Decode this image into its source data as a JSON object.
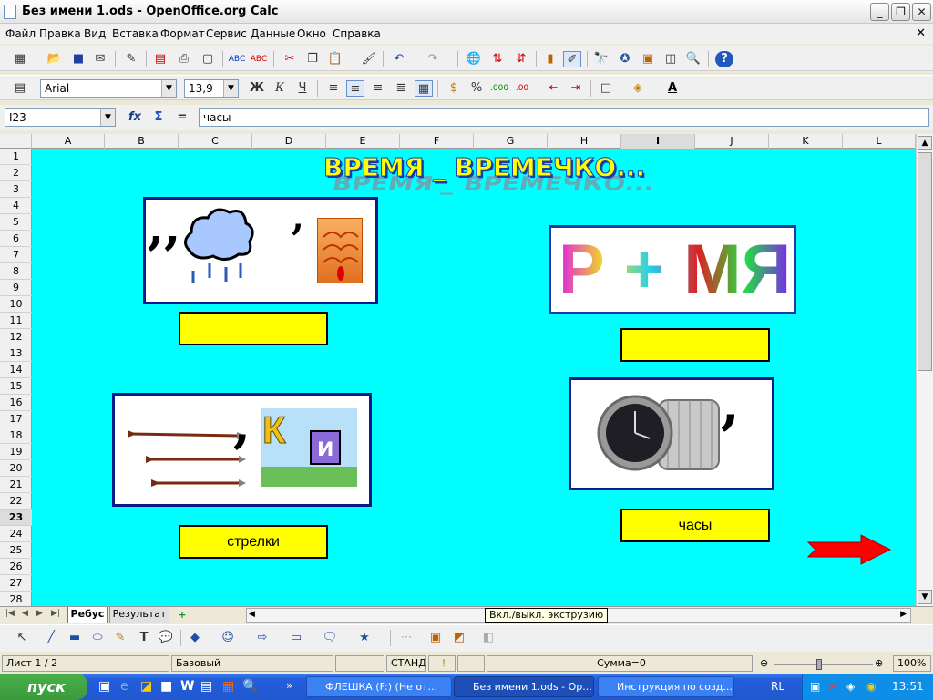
{
  "window": {
    "title": "Без имени 1.ods - OpenOffice.org Calc"
  },
  "menu": [
    "Файл",
    "Правка",
    "Вид",
    "Вставка",
    "Формат",
    "Сервис",
    "Данные",
    "Окно",
    "Справка"
  ],
  "font_toolbar": {
    "font_name": "Arial",
    "font_size": "13,9",
    "bold": "Ж",
    "italic": "К",
    "underline": "Ч"
  },
  "formula_bar": {
    "cell_ref": "I23",
    "content": "часы",
    "fx": "fx",
    "sum": "Σ",
    "eq": "="
  },
  "columns": [
    "A",
    "B",
    "C",
    "D",
    "E",
    "F",
    "G",
    "H",
    "I",
    "J",
    "K",
    "L"
  ],
  "rows": [
    "1",
    "2",
    "3",
    "4",
    "5",
    "6",
    "7",
    "8",
    "9",
    "10",
    "11",
    "12",
    "13",
    "14",
    "15",
    "16",
    "17",
    "18",
    "19",
    "20",
    "21",
    "22",
    "23",
    "24",
    "25",
    "26",
    "27",
    "28"
  ],
  "sheet": {
    "title": "ВРЕМЯ _ ВРЕМЕЧКО...",
    "answers": [
      "",
      "",
      "стрелки",
      "часы"
    ],
    "puzzle2_text": "Р + МЯ",
    "puzzle3_letter": "К",
    "puzzle3_letter2": "и",
    "background_color": "#00ffff",
    "answer_color": "#ffff00"
  },
  "sheet_tabs": [
    "Ребус",
    "Результат"
  ],
  "tooltip": "Вкл./выкл. экструзию",
  "status": {
    "sheet": "Лист 1 / 2",
    "style": "Базовый",
    "mode": "СТАНД",
    "sum": "Сумма=0",
    "zoom": "100%"
  },
  "taskbar": {
    "start": "пуск",
    "tasks": [
      "ФЛЕШКА (F:) (Не от...",
      "Без имени 1.ods - Op...",
      "Инструкция по созд..."
    ],
    "lang": "RL",
    "clock": "13:51"
  }
}
